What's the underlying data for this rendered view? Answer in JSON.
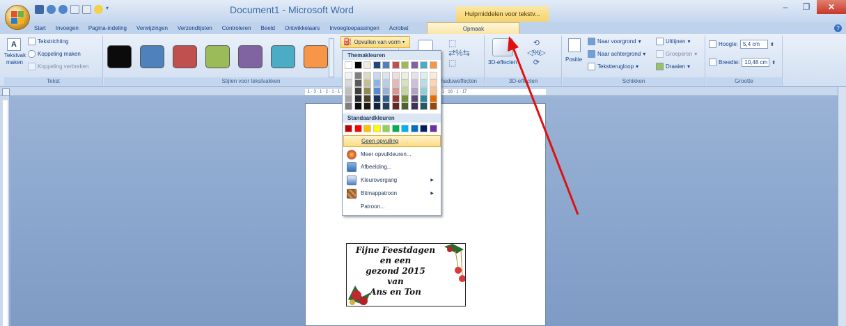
{
  "window": {
    "title": "Document1 - Microsoft Word",
    "context_tab_header": "Hulpmiddelen voor tekstv...",
    "min_label": "–",
    "max_label": "❐",
    "close_label": "✕"
  },
  "tabs": [
    "Start",
    "Invoegen",
    "Pagina-indeling",
    "Verwijzingen",
    "Verzendlijsten",
    "Controleren",
    "Beeld",
    "Ontwikkelaars",
    "Invoegtoepassingen",
    "Acrobat",
    "Opmaak"
  ],
  "active_tab": "Opmaak",
  "ribbon": {
    "tekst": {
      "label": "Tekst",
      "tekstvak_maken": "Tekstvak maken",
      "tekstrichting": "Tekstrichting",
      "koppeling_maken": "Koppeling maken",
      "koppeling_verbreken": "Koppeling verbreken"
    },
    "stijlen": {
      "label": "Stijlen voor tekstvakken",
      "swatch_colors": [
        "#0b0b0b",
        "#4f81bd",
        "#c0504d",
        "#9bbb59",
        "#8064a2",
        "#4bacc6",
        "#f79646"
      ],
      "opvullen": "Opvullen van vorm"
    },
    "schaduw": {
      "label": "Schaduweffecten"
    },
    "effecten3d": {
      "label": "3D-effecten",
      "button": "3D-effecten"
    },
    "schikken": {
      "label": "Schikken",
      "positie": "Positie",
      "naar_voorgrond": "Naar voorgrond",
      "naar_achtergrond": "Naar achtergrond",
      "tekstterugloop": "Tekstterugloop",
      "uitlijnen": "Uitlijnen",
      "groeperen": "Groeperen",
      "draaien": "Draaien"
    },
    "grootte": {
      "label": "Grootte",
      "hoogte_label": "Hoogte:",
      "hoogte_value": "5,4 cm",
      "breedte_label": "Breedte:",
      "breedte_value": "10,48 cm"
    }
  },
  "ruler_text": "· 1 · 3 · 1 · 2 · 1 · 1 · 1 · 9 · 1 · 10 · 1 · 11 · 1 · 12 · 1 · 13 · 1 · 14 · 1 · 15 · 1 · 16 · 1 · 17",
  "fill_menu": {
    "theme_header": "Themakleuren",
    "theme_top": [
      "#ffffff",
      "#000000",
      "#eeece1",
      "#1f497d",
      "#4f81bd",
      "#c0504d",
      "#9bbb59",
      "#8064a2",
      "#4bacc6",
      "#f79646"
    ],
    "theme_columns": [
      [
        "#f2f2f2",
        "#d8d8d8",
        "#bfbfbf",
        "#a5a5a5",
        "#7f7f7f"
      ],
      [
        "#7f7f7f",
        "#595959",
        "#3f3f3f",
        "#262626",
        "#0c0c0c"
      ],
      [
        "#ddd9c3",
        "#c4bd97",
        "#938953",
        "#494429",
        "#1d1b10"
      ],
      [
        "#c6d9f0",
        "#8db3e2",
        "#548dd4",
        "#17365d",
        "#0f243e"
      ],
      [
        "#dbe5f1",
        "#b8cce4",
        "#95b3d7",
        "#366092",
        "#244061"
      ],
      [
        "#f2dcdb",
        "#e5b9b7",
        "#d99694",
        "#953734",
        "#632423"
      ],
      [
        "#ebf1dd",
        "#d7e3bc",
        "#c3d69b",
        "#76923c",
        "#4f6128"
      ],
      [
        "#e5e0ec",
        "#ccc1d9",
        "#b2a2c7",
        "#5f497a",
        "#3f3151"
      ],
      [
        "#dbeef3",
        "#b7dde8",
        "#92cddc",
        "#31859b",
        "#205867"
      ],
      [
        "#fdeada",
        "#fbd5b5",
        "#fac08f",
        "#e36c09",
        "#974806"
      ]
    ],
    "standard_header": "Standaardkleuren",
    "standard": [
      "#c00000",
      "#ff0000",
      "#ffc000",
      "#ffff00",
      "#92d050",
      "#00b050",
      "#00b0f0",
      "#0070c0",
      "#002060",
      "#7030a0"
    ],
    "items": {
      "geen": "Geen opvulling",
      "meer": "Meer opvulkleuren...",
      "afbeelding": "Afbeelding...",
      "kleurovergang": "Kleurovergang",
      "bitmappatroon": "Bitmappatroon",
      "patroon": "Patroon..."
    }
  },
  "card": {
    "lines": [
      "Fijne Feestdagen",
      "en een",
      "gezond 2015",
      "van",
      "Ans en Ton"
    ]
  }
}
